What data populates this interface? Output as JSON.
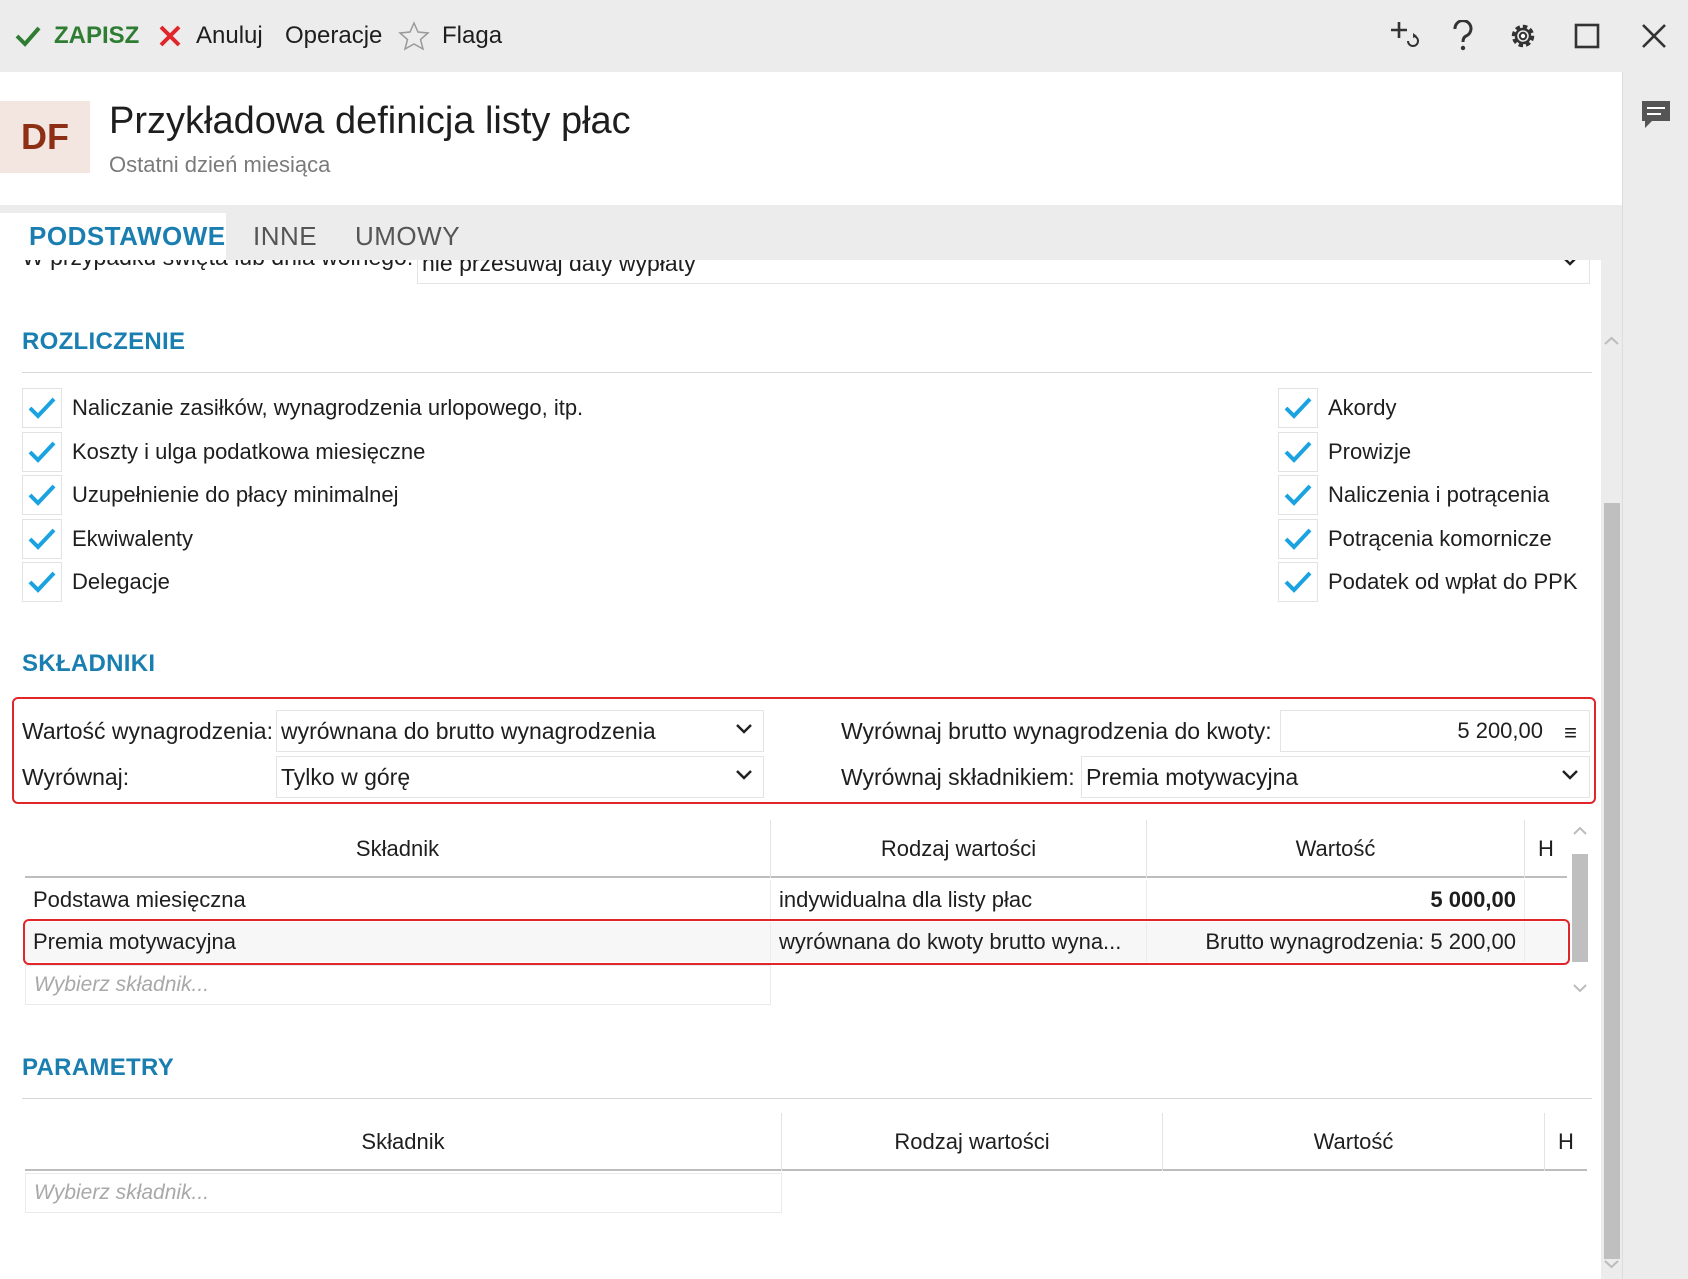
{
  "toolbar": {
    "save_label": "ZAPISZ",
    "cancel_label": "Anuluj",
    "operations_label": "Operacje",
    "flag_label": "Flaga"
  },
  "header": {
    "avatar": "DF",
    "title": "Przykładowa definicja listy płac",
    "subtitle": "Ostatni dzień miesiąca"
  },
  "tabs": [
    {
      "label": "PODSTAWOWE",
      "active": true
    },
    {
      "label": "INNE",
      "active": false
    },
    {
      "label": "UMOWY",
      "active": false
    }
  ],
  "holiday": {
    "label": "W przypadku święta lub dnia wolnego:",
    "value": "nie przesuwaj daty wypłaty"
  },
  "rozliczenie": {
    "title": "ROZLICZENIE",
    "left": [
      {
        "label": "Naliczanie zasiłków, wynagrodzenia urlopowego, itp.",
        "checked": true
      },
      {
        "label": "Koszty i ulga podatkowa miesięczne",
        "checked": true
      },
      {
        "label": "Uzupełnienie do płacy minimalnej",
        "checked": true
      },
      {
        "label": "Ekwiwalenty",
        "checked": true
      },
      {
        "label": "Delegacje",
        "checked": true
      }
    ],
    "right": [
      {
        "label": "Akordy",
        "checked": true
      },
      {
        "label": "Prowizje",
        "checked": true
      },
      {
        "label": "Naliczenia i potrącenia",
        "checked": true
      },
      {
        "label": "Potrącenia komornicze",
        "checked": true
      },
      {
        "label": "Podatek od wpłat do PPK",
        "checked": true
      }
    ]
  },
  "skladniki": {
    "title": "SKŁADNIKI",
    "wartosc_label": "Wartość wynagrodzenia:",
    "wartosc_value": "wyrównana do brutto wynagrodzenia",
    "wyrownaj_label": "Wyrównaj:",
    "wyrownaj_value": "Tylko w górę",
    "kwota_label": "Wyrównaj brutto wynagrodzenia do kwoty:",
    "kwota_value": "5 200,00",
    "skladnikiem_label": "Wyrównaj składnikiem:",
    "skladnikiem_value": "Premia motywacyjna",
    "columns": [
      "Składnik",
      "Rodzaj wartości",
      "Wartość",
      "H"
    ],
    "rows": [
      {
        "skladnik": "Podstawa miesięczna",
        "rodzaj": "indywidualna dla listy płac",
        "wartosc": "5 000,00"
      },
      {
        "skladnik": "Premia motywacyjna",
        "rodzaj": "wyrównana do kwoty brutto wyna...",
        "wartosc": "Brutto wynagrodzenia: 5 200,00"
      }
    ],
    "placeholder": "Wybierz składnik..."
  },
  "parametry": {
    "title": "PARAMETRY",
    "columns": [
      "Składnik",
      "Rodzaj wartości",
      "Wartość",
      "H"
    ],
    "placeholder": "Wybierz składnik..."
  },
  "colors": {
    "accent": "#1a7fb0",
    "save_green": "#2e7d32",
    "cancel_red": "#e0262b",
    "check_blue": "#1aa3e0",
    "highlight_red": "#e0262b"
  }
}
